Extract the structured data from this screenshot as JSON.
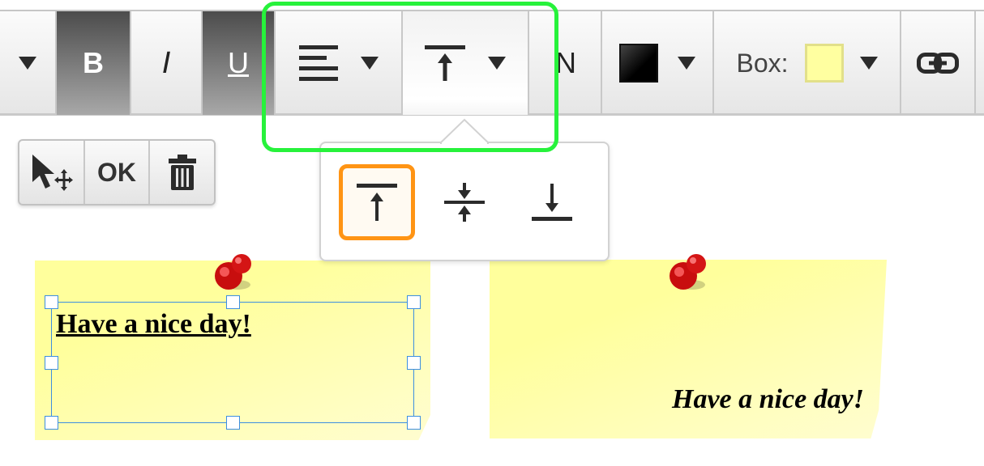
{
  "toolbar": {
    "buttons": {
      "bold": "B",
      "italic": "I",
      "underline": "U",
      "font_fragment": "N",
      "box_label": "Box:"
    },
    "colors": {
      "text_color": "#000000",
      "box_color": "#ffffa0"
    },
    "icons": {
      "dropdown": "chevron-down-icon",
      "align": "align-left-icon",
      "valign": "align-top-icon",
      "link": "link-icon"
    }
  },
  "mini_toolbar": {
    "ok_label": "OK",
    "icons": [
      "move-icon",
      "trash-icon"
    ]
  },
  "valign_popover": {
    "options": [
      "align-top",
      "align-middle",
      "align-bottom"
    ],
    "selected": "align-top"
  },
  "notes": [
    {
      "text": "Have a nice day!",
      "style": "bold underline",
      "valign": "top",
      "selected": true
    },
    {
      "text": "Have a nice day!",
      "style": "bold italic",
      "valign": "bottom",
      "selected": false
    }
  ],
  "highlight_color": "#27f23b",
  "selected_option_color": "#ff9414"
}
